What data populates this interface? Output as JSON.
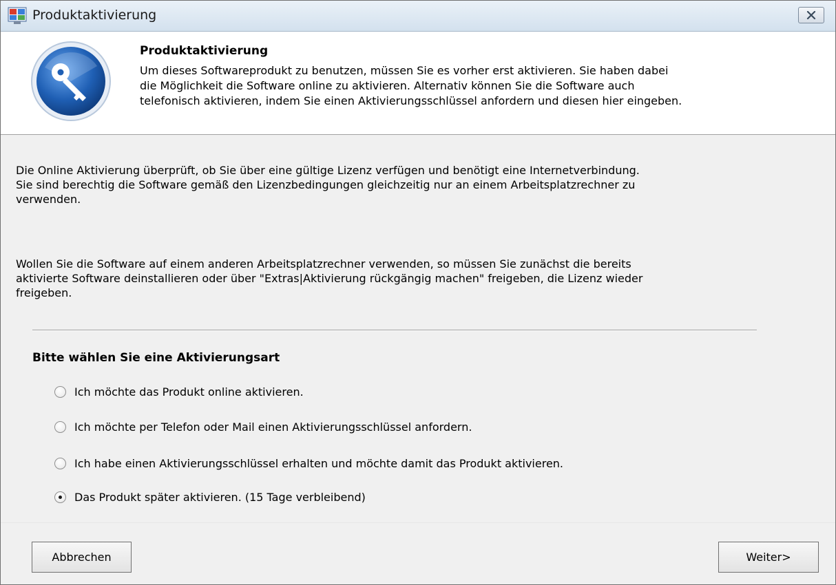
{
  "window": {
    "title": "Produktaktivierung",
    "icons": {
      "app": "app-window-icon",
      "close": "close-icon"
    }
  },
  "header": {
    "icon": "key-icon",
    "title": "Produktaktivierung",
    "lines": [
      "Um dieses Softwareprodukt zu benutzen, müssen Sie es vorher erst aktivieren. Sie haben dabei",
      "die Möglichkeit die Software online zu aktivieren. Alternativ können Sie die Software auch",
      "telefonisch aktivieren, indem Sie einen Aktivierungsschlüssel anfordern und diesen hier eingeben."
    ]
  },
  "info": {
    "para1": [
      "Die Online Aktivierung überprüft, ob Sie über eine gültige Lizenz verfügen und benötigt eine Internetverbindung.",
      "Sie sind berechtig die Software gemäß den Lizenzbedingungen gleichzeitig nur an einem Arbeitsplatzrechner zu",
      "verwenden."
    ],
    "para2": [
      "Wollen Sie die Software auf einem anderen Arbeitsplatzrechner verwenden, so müssen Sie zunächst die bereits",
      "aktivierte Software deinstallieren oder über \"Extras|Aktivierung rückgängig machen\" freigeben, die Lizenz wieder",
      "freigeben."
    ]
  },
  "activation": {
    "heading": "Bitte wählen Sie eine Aktivierungsart",
    "options": [
      {
        "label": "Ich möchte das Produkt online aktivieren.",
        "checked": false
      },
      {
        "label": "Ich möchte per Telefon oder Mail einen Aktivierungsschlüssel anfordern.",
        "checked": false
      },
      {
        "label": "Ich habe einen Aktivierungsschlüssel erhalten und möchte damit das Produkt aktivieren.",
        "checked": false
      },
      {
        "label": "Das Produkt später aktivieren. (15 Tage verbleibend)",
        "checked": true
      }
    ]
  },
  "buttons": {
    "cancel": "Abbrechen",
    "next": "Weiter>"
  },
  "colors": {
    "title_bar": "#d3e1ee",
    "dialog_bg": "#f0f0f0",
    "header_bg": "#ffffff",
    "key_icon_blue": "#1f5fb4"
  }
}
